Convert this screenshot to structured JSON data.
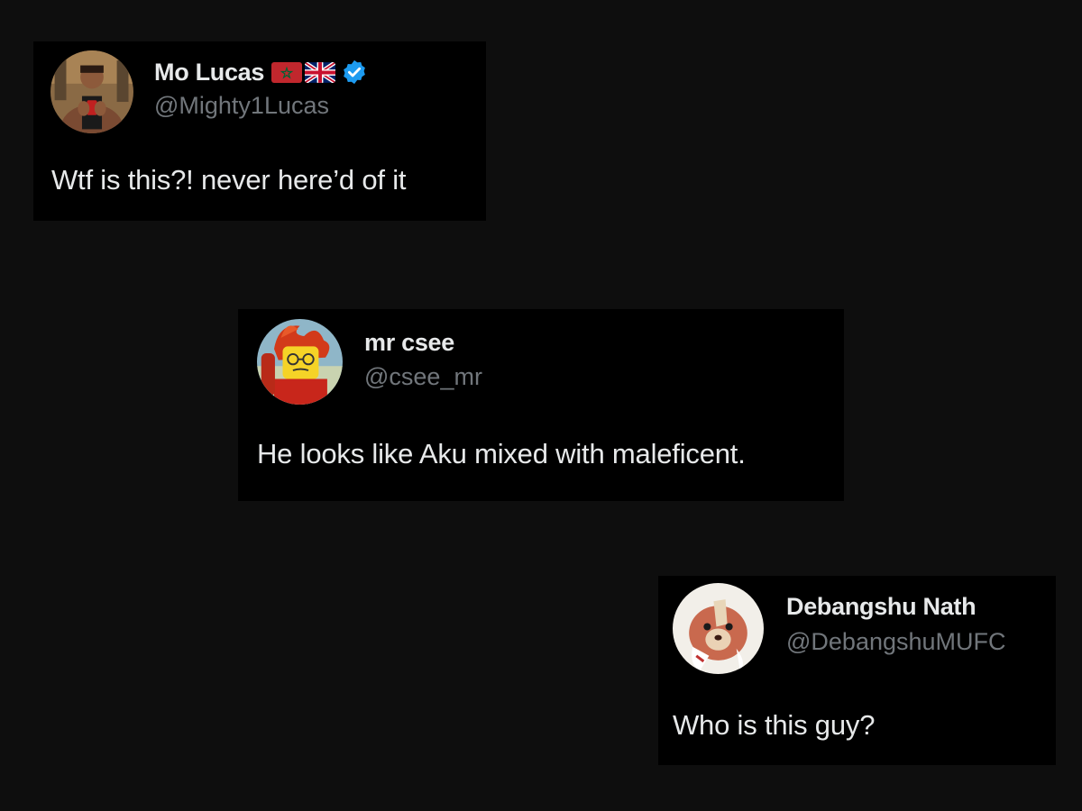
{
  "tweets": [
    {
      "display_name": "Mo Lucas",
      "handle": "@Mighty1Lucas",
      "text": "Wtf is this?! never here’d of it",
      "badges": [
        "morocco-flag-icon",
        "uk-flag-icon",
        "verified-badge-icon"
      ]
    },
    {
      "display_name": "mr csee",
      "handle": "@csee_mr",
      "text": "He looks like Aku mixed with maleficent."
    },
    {
      "display_name": "Debangshu Nath",
      "handle": "@DebangshuMUFC",
      "text": "Who is this guy?"
    }
  ],
  "colors": {
    "background": "#0e0e0e",
    "card": "#000000",
    "primary_text": "#e7e9ea",
    "secondary_text": "#71767b",
    "verified_blue": "#1d9bf0",
    "morocco_red": "#c1272d",
    "morocco_green": "#006233"
  }
}
